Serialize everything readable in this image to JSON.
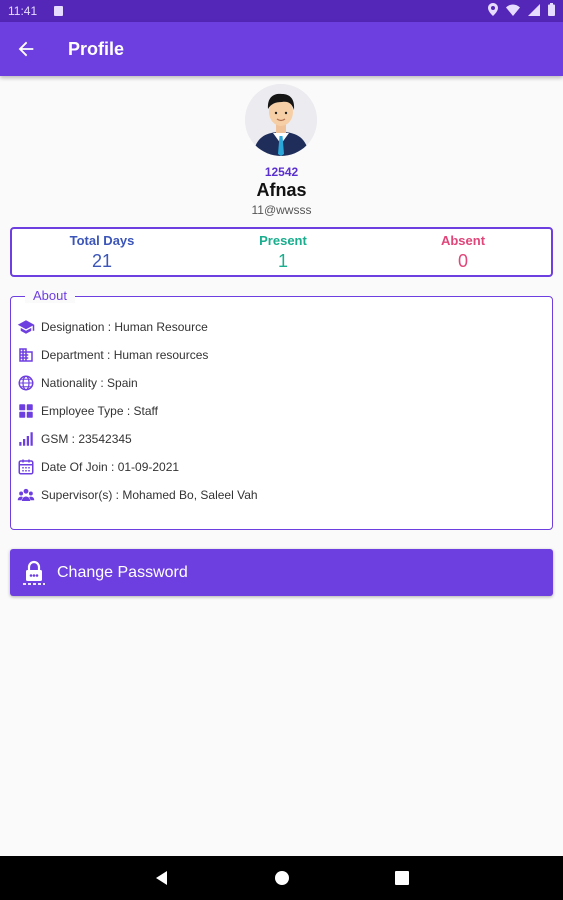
{
  "status": {
    "time": "11:41"
  },
  "app_bar": {
    "title": "Profile",
    "back_icon": "arrow-left-icon"
  },
  "profile": {
    "employee_id": "12542",
    "name": "Afnas",
    "email": "11@wwsss"
  },
  "stats": [
    {
      "label": "Total Days",
      "value": "21",
      "color": "#3b55b8"
    },
    {
      "label": "Present",
      "value": "1",
      "color": "#1aae8e"
    },
    {
      "label": "Absent",
      "value": "0",
      "color": "#e0467a"
    }
  ],
  "about": {
    "title": "About",
    "rows": [
      {
        "icon": "graduation-cap-icon",
        "text": "Designation : Human Resource"
      },
      {
        "icon": "building-icon",
        "text": "Department : Human resources"
      },
      {
        "icon": "globe-icon",
        "text": "Nationality : Spain"
      },
      {
        "icon": "grid-icon",
        "text": "Employee Type : Staff"
      },
      {
        "icon": "signal-bars-icon",
        "text": "GSM : 23542345"
      },
      {
        "icon": "calendar-icon",
        "text": "Date Of Join : 01-09-2021"
      },
      {
        "icon": "group-icon",
        "text": "Supervisor(s) : Mohamed Bo, Saleel Vah"
      }
    ]
  },
  "actions": {
    "change_password": "Change Password",
    "change_password_icon": "lock-icon"
  },
  "colors": {
    "primary": "#6e3fe0",
    "status_bar": "#5427b8",
    "present": "#1aae8e",
    "absent": "#e0467a",
    "total": "#3b55b8"
  }
}
